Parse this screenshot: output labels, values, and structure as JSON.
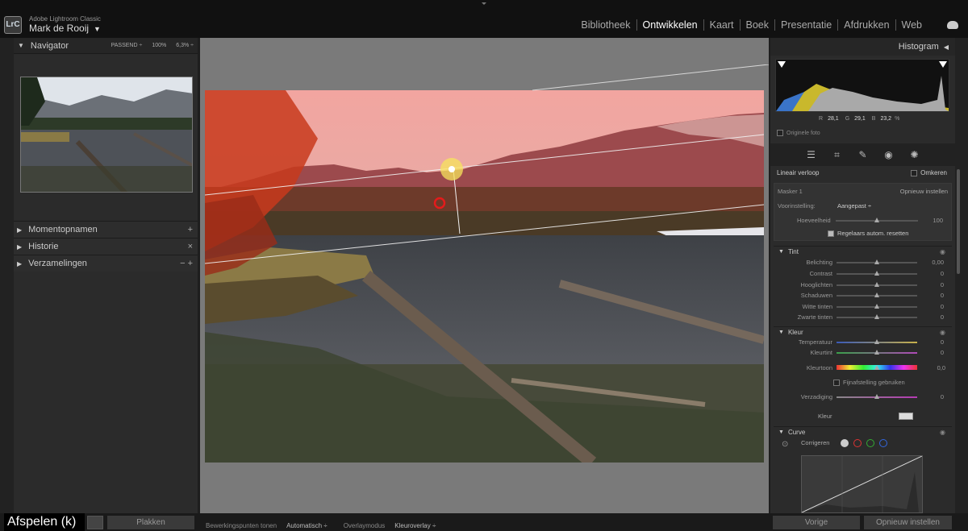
{
  "app": {
    "name": "Adobe Lightroom Classic",
    "logo": "LrC",
    "user": "Mark de Rooij"
  },
  "modules": [
    "Bibliotheek",
    "Ontwikkelen",
    "Kaart",
    "Boek",
    "Presentatie",
    "Afdrukken",
    "Web"
  ],
  "active_module": "Ontwikkelen",
  "left": {
    "navigator": {
      "title": "Navigator",
      "opts": [
        "PASSEND ÷",
        "100%",
        "6,3% ÷"
      ]
    },
    "sections": [
      {
        "label": "Momentopnamen",
        "action": "+"
      },
      {
        "label": "Historie",
        "action": "×"
      },
      {
        "label": "Verzamelingen",
        "action": "− +"
      }
    ]
  },
  "bottom": {
    "play": "Afspelen (k)",
    "paste": "Plakken",
    "editpoints_label": "Bewerkingspunten tonen",
    "editpoints_value": "Automatisch ÷",
    "overlay_label": "Overlaymodus",
    "overlay_value": "Kleuroverlay ÷",
    "prev": "Vorige",
    "reset": "Opnieuw instellen"
  },
  "right": {
    "histogram_title": "Histogram",
    "rgb": {
      "r_label": "R",
      "r": "28,1",
      "g_label": "G",
      "g": "29,1",
      "b_label": "B",
      "b": "23,2",
      "unit": "%"
    },
    "original": "Originele foto",
    "mask_type": "Lineair verloop",
    "invert": "Omkeren",
    "mask_name": "Masker 1",
    "mask_reset": "Opnieuw instellen",
    "preset_label": "Voorinstelling:",
    "preset_value": "Aangepast ÷",
    "amount_label": "Hoeveelheid",
    "amount_value": "100",
    "auto_reset": "Regelaars autom. resetten",
    "tint_title": "Tint",
    "tint": [
      {
        "label": "Belichting",
        "value": "0,00"
      },
      {
        "label": "Contrast",
        "value": "0"
      },
      {
        "label": "Hooglichten",
        "value": "0"
      },
      {
        "label": "Schaduwen",
        "value": "0"
      },
      {
        "label": "Witte tinten",
        "value": "0"
      },
      {
        "label": "Zwarte tinten",
        "value": "0"
      }
    ],
    "color_title": "Kleur",
    "temp_label": "Temperatuur",
    "temp_value": "0",
    "tint_label": "Kleurtint",
    "tint_value": "0",
    "hue_label": "Kleurtoon",
    "hue_value": "0,0",
    "fine": "Fijnafstelling gebruiken",
    "sat_label": "Verzadiging",
    "sat_value": "0",
    "color_label": "Kleur",
    "curve_title": "Curve",
    "curve_correct": "Corrigeren"
  }
}
